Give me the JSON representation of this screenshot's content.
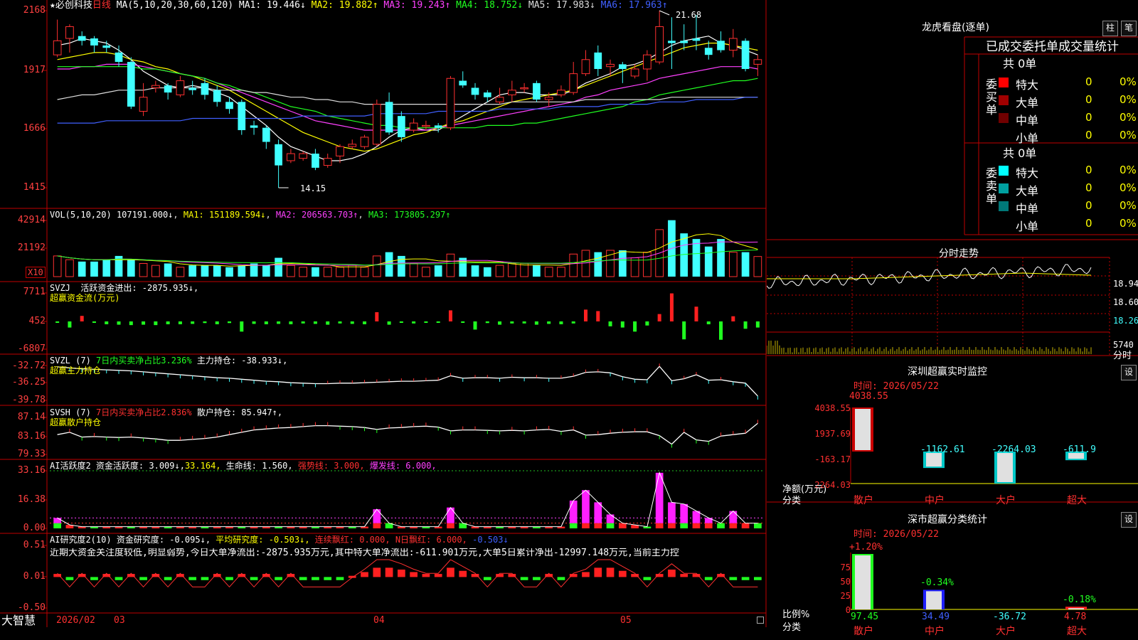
{
  "header": {
    "star": "★",
    "stock_name": "必创科技",
    "period": "日线",
    "ma_title": "MA(5,10,20,30,60,120)",
    "ma": [
      {
        "label": "MA1: 19.446↓",
        "color": "#ffffff"
      },
      {
        "label": "MA2: 19.882↑",
        "color": "#ffff00"
      },
      {
        "label": "MA3: 19.243↑",
        "color": "#ff40ff"
      },
      {
        "label": "MA4: 18.752↓",
        "color": "#20ff20"
      },
      {
        "label": "MA5: 17.983↓",
        "color": "#dddddd"
      },
      {
        "label": "MA6: 17.963↑",
        "color": "#4060ff"
      }
    ],
    "max_price": "21.68",
    "min_price": "14.15"
  },
  "price_axis": [
    "2168",
    "1917",
    "1666",
    "1415"
  ],
  "vol": {
    "title": "VOL(5,10,20)",
    "value": "107191.000↓",
    "ma1": "MA1: 151189.594↓",
    "ma2": "MA2: 206563.703↑",
    "ma3": "MA3: 173805.297↑",
    "axis": [
      "42914",
      "21192"
    ],
    "unit": "X10"
  },
  "svzj": {
    "title": "SVZJ",
    "line1": "活跃资金进出: -2875.935↓,",
    "line2": "超赢资金流(万元)",
    "axis": [
      "7711",
      "452",
      "-6807"
    ]
  },
  "svzl": {
    "title": "SVZL (7)",
    "pct": "7日内买卖净占比3.236%",
    "hold": "主力持仓: -38.933↓,",
    "line2": "超赢主力持仓",
    "axis": [
      "-32.72",
      "-36.25",
      "-39.78"
    ]
  },
  "svsh": {
    "title": "SVSH (7)",
    "pct": "7日内买卖净占比2.836%",
    "hold": "散户持仓: 85.947↑,",
    "line2": "超赢散户持仓",
    "axis": [
      "87.14",
      "83.16",
      "79.33"
    ]
  },
  "ai1": {
    "title": "AI活跃度2",
    "v1": "资金活跃度: 3.009↓,",
    "v2": "33.164,",
    "v3": "生命线: 1.560,",
    "v4": "强势线: 3.000,",
    "v5": "爆发线: 6.000,",
    "axis": [
      "33.16",
      "16.38",
      "0.00"
    ]
  },
  "ai2": {
    "title": "AI研究度2(10)",
    "v1": "资金研究度: -0.095↓,",
    "v2": "平均研究度: -0.503↓,",
    "v3": "连续飘红: 0.000,",
    "v4": "N日飘红: 6.000,",
    "v5": "-0.503↓",
    "note": "近期大资金关注度较低,明显弱势,今日大单净流出:-2875.935万元,其中特大单净流出:-611.901万元,大单5日累计净出-12997.148万元,当前主力控",
    "axis": [
      "0.51",
      "0.01",
      "-0.50"
    ]
  },
  "dates": {
    "brand": "大智慧",
    "labels": [
      "2026/02",
      "03",
      "04",
      "05"
    ]
  },
  "right": {
    "lhb_title": "龙虎看盘(逐单)",
    "btn_zhu": "柱",
    "btn_bi": "笔",
    "tabs": "已成交委托单成交量统计",
    "buy_label": "委买单",
    "sell_label": "委卖单",
    "buy_total": "共 0单",
    "sell_total": "共 0单",
    "buy_rows": [
      {
        "name": "特大",
        "n": "0",
        "p": "0%",
        "color": "#ff0000"
      },
      {
        "name": "大单",
        "n": "0",
        "p": "0%",
        "color": "#a00000"
      },
      {
        "name": "中单",
        "n": "0",
        "p": "0%",
        "color": "#700000"
      },
      {
        "name": "小单",
        "n": "0",
        "p": "0%",
        "color": ""
      }
    ],
    "sell_rows": [
      {
        "name": "特大",
        "n": "0",
        "p": "0%",
        "color": "#00ffff"
      },
      {
        "name": "大单",
        "n": "0",
        "p": "0%",
        "color": "#00a0a0"
      },
      {
        "name": "中单",
        "n": "0",
        "p": "0%",
        "color": "#007878"
      },
      {
        "name": "小单",
        "n": "0",
        "p": "0%",
        "color": ""
      }
    ],
    "fs_title": "分时走势",
    "fs_axis": [
      "18.94",
      "18.60",
      "18.26",
      "5740",
      "分时"
    ],
    "sz_title": "深圳超赢实时监控",
    "sz_btn": "设",
    "sz_time": "时间: 2026/05/22",
    "sz_axis": [
      "4038.55",
      "1937.69",
      "-163.17",
      "-2264.03"
    ],
    "sz_unit": "净额(万元)",
    "sz_cat": "分类",
    "sz_bars": [
      {
        "name": "散户",
        "value": 4038.55,
        "label": "4038.55"
      },
      {
        "name": "中户",
        "value": -1162.61,
        "label": "-1162.61"
      },
      {
        "name": "大户",
        "value": -2264.03,
        "label": "-2264.03"
      },
      {
        "name": "超大",
        "value": -611.9,
        "label": "-611.9"
      }
    ],
    "fl_title": "深市超赢分类统计",
    "fl_btn": "设",
    "fl_time": "时间: 2026/05/22",
    "fl_axis": [
      "75",
      "50",
      "25",
      "0"
    ],
    "fl_unit": "比例%",
    "fl_cat": "分类",
    "fl_bars": [
      {
        "name": "散户",
        "pct": "+1.20%",
        "ratio": 97.45,
        "val": "97.45"
      },
      {
        "name": "中户",
        "pct": "-0.34%",
        "ratio": 34.49,
        "val": "34.49"
      },
      {
        "name": "大户",
        "pct": "",
        "ratio": 0,
        "val": "-36.72"
      },
      {
        "name": "超大",
        "pct": "-0.18%",
        "ratio": 4.78,
        "val": "4.78"
      }
    ]
  },
  "chart_data": {
    "type": "candlestick",
    "y_range": [
      14.15,
      21.68
    ],
    "candles": [
      [
        19.8,
        20.4,
        21.3,
        19.7
      ],
      [
        20.5,
        21.0,
        21.1,
        19.9
      ],
      [
        20.6,
        20.4,
        20.8,
        20.2
      ],
      [
        20.5,
        20.2,
        20.6,
        19.9
      ],
      [
        20.2,
        20.1,
        20.4,
        19.9
      ],
      [
        19.9,
        19.5,
        20.2,
        19.3
      ],
      [
        19.5,
        17.6,
        19.7,
        17.5
      ],
      [
        17.4,
        18.0,
        18.6,
        17.2
      ],
      [
        18.4,
        18.5,
        18.7,
        18.2
      ],
      [
        18.5,
        18.2,
        18.6,
        17.9
      ],
      [
        18.1,
        18.7,
        18.9,
        18.0
      ],
      [
        18.4,
        18.3,
        18.7,
        18.1
      ],
      [
        18.6,
        18.1,
        18.8,
        17.9
      ],
      [
        18.3,
        17.8,
        18.5,
        17.6
      ],
      [
        17.8,
        17.5,
        18.0,
        17.3
      ],
      [
        17.8,
        16.6,
        17.9,
        16.4
      ],
      [
        16.8,
        16.7,
        17.0,
        16.4
      ],
      [
        16.7,
        16.1,
        16.8,
        15.8
      ],
      [
        16.0,
        15.1,
        16.2,
        14.15
      ],
      [
        15.3,
        15.6,
        15.8,
        15.2
      ],
      [
        15.4,
        15.6,
        15.7,
        15.3
      ],
      [
        15.6,
        15.0,
        15.8,
        14.9
      ],
      [
        15.1,
        15.4,
        15.6,
        15.0
      ],
      [
        15.5,
        15.9,
        16.0,
        15.2
      ],
      [
        15.9,
        16.0,
        16.2,
        15.8
      ],
      [
        15.9,
        16.3,
        16.4,
        15.8
      ],
      [
        16.0,
        17.7,
        17.9,
        15.9
      ],
      [
        17.8,
        16.5,
        18.2,
        16.4
      ],
      [
        17.2,
        16.3,
        17.4,
        16.1
      ],
      [
        16.6,
        16.9,
        17.1,
        16.5
      ],
      [
        16.8,
        16.8,
        17.0,
        16.6
      ],
      [
        16.8,
        16.7,
        16.9,
        16.5
      ],
      [
        16.7,
        18.8,
        18.9,
        16.6
      ],
      [
        18.7,
        18.5,
        19.1,
        18.4
      ],
      [
        18.4,
        18.1,
        18.6,
        17.9
      ],
      [
        18.2,
        18.0,
        18.3,
        17.8
      ],
      [
        17.8,
        18.0,
        18.4,
        17.7
      ],
      [
        18.1,
        18.3,
        18.7,
        17.8
      ],
      [
        18.4,
        18.4,
        18.6,
        18.2
      ],
      [
        18.6,
        17.9,
        18.7,
        17.8
      ],
      [
        17.9,
        18.0,
        18.2,
        17.6
      ],
      [
        18.1,
        18.3,
        18.5,
        18.0
      ],
      [
        18.2,
        19.0,
        19.5,
        18.1
      ],
      [
        19.0,
        19.6,
        20.0,
        18.9
      ],
      [
        19.9,
        19.2,
        20.2,
        18.9
      ],
      [
        19.3,
        19.4,
        19.6,
        18.9
      ],
      [
        19.4,
        19.2,
        19.5,
        18.6
      ],
      [
        18.9,
        19.2,
        19.4,
        18.8
      ],
      [
        19.2,
        19.8,
        20.0,
        18.7
      ],
      [
        19.5,
        21.0,
        21.68,
        19.4
      ],
      [
        20.4,
        20.3,
        21.4,
        19.2
      ],
      [
        20.4,
        20.3,
        21.1,
        20.0
      ],
      [
        20.5,
        20.4,
        21.5,
        20.0
      ],
      [
        20.1,
        19.8,
        20.4,
        19.6
      ],
      [
        20.4,
        20.0,
        20.8,
        19.9
      ],
      [
        20.0,
        20.5,
        20.9,
        19.7
      ],
      [
        20.4,
        19.2,
        20.5,
        19.1
      ],
      [
        19.4,
        19.6,
        19.8,
        18.9
      ]
    ],
    "ma_lines": [
      {
        "name": "MA1",
        "color": "#ffffff",
        "values": [
          20.2,
          20.3,
          20.5,
          20.4,
          20.3,
          20.0,
          19.6,
          19.1,
          18.8,
          18.5,
          18.4,
          18.5,
          18.4,
          18.2,
          18.0,
          17.6,
          17.2,
          16.8,
          16.3,
          15.9,
          15.7,
          15.5,
          15.3,
          15.3,
          15.4,
          15.6,
          15.9,
          16.3,
          16.6,
          16.7,
          16.6,
          16.6,
          16.9,
          17.2,
          17.5,
          17.8,
          18.1,
          18.2,
          18.2,
          18.1,
          18.1,
          18.1,
          18.3,
          18.6,
          18.8,
          19.0,
          19.3,
          19.4,
          19.6,
          19.9,
          20.2,
          20.4,
          20.5,
          20.6,
          20.3,
          20.2,
          20.0,
          19.8
        ]
      },
      {
        "name": "MA2",
        "color": "#ffff00",
        "values": [
          19.6,
          19.7,
          19.8,
          19.9,
          19.9,
          19.8,
          19.6,
          19.5,
          19.3,
          19.2,
          19.0,
          18.9,
          18.7,
          18.5,
          18.3,
          18.0,
          17.7,
          17.4,
          17.1,
          16.8,
          16.5,
          16.3,
          16.1,
          15.9,
          15.8,
          15.7,
          15.8,
          16.0,
          16.2,
          16.4,
          16.5,
          16.7,
          16.9,
          17.0,
          17.2,
          17.4,
          17.6,
          17.8,
          17.9,
          18.0,
          18.1,
          18.2,
          18.3,
          18.5,
          18.7,
          18.9,
          19.1,
          19.3,
          19.5,
          19.7,
          19.9,
          20.1,
          20.2,
          20.3,
          20.3,
          20.2,
          20.1,
          20.0
        ]
      },
      {
        "name": "MA3",
        "color": "#ff40ff",
        "values": [
          19.2,
          19.2,
          19.3,
          19.3,
          19.4,
          19.4,
          19.4,
          19.3,
          19.2,
          19.1,
          19.0,
          18.9,
          18.8,
          18.6,
          18.4,
          18.2,
          18.0,
          17.8,
          17.6,
          17.4,
          17.2,
          17.0,
          16.9,
          16.8,
          16.7,
          16.6,
          16.6,
          16.6,
          16.6,
          16.6,
          16.6,
          16.7,
          16.8,
          16.9,
          17.0,
          17.1,
          17.2,
          17.3,
          17.4,
          17.5,
          17.6,
          17.7,
          17.8,
          18.0,
          18.1,
          18.3,
          18.4,
          18.5,
          18.6,
          18.8,
          18.9,
          19.0,
          19.1,
          19.2,
          19.3,
          19.3,
          19.3,
          19.2
        ]
      },
      {
        "name": "MA4",
        "color": "#20ff20",
        "values": [
          19.3,
          19.3,
          19.3,
          19.3,
          19.3,
          19.3,
          19.3,
          19.2,
          19.2,
          19.1,
          19.0,
          18.9,
          18.8,
          18.6,
          18.5,
          18.3,
          18.2,
          18.0,
          17.8,
          17.6,
          17.5,
          17.4,
          17.2,
          17.1,
          17.0,
          16.9,
          16.8,
          16.8,
          16.7,
          16.7,
          16.7,
          16.7,
          16.7,
          16.7,
          16.7,
          16.8,
          16.8,
          16.8,
          16.9,
          16.9,
          17.0,
          17.1,
          17.2,
          17.3,
          17.4,
          17.5,
          17.6,
          17.8,
          17.9,
          18.1,
          18.2,
          18.3,
          18.4,
          18.5,
          18.6,
          18.7,
          18.7,
          18.8
        ]
      },
      {
        "name": "MA5",
        "color": "#dddddd",
        "values": [
          17.9,
          18.0,
          18.1,
          18.1,
          18.2,
          18.3,
          18.3,
          18.3,
          18.4,
          18.4,
          18.4,
          18.4,
          18.4,
          18.3,
          18.3,
          18.3,
          18.2,
          18.2,
          18.1,
          18.0,
          18.0,
          17.9,
          17.9,
          17.8,
          17.8,
          17.7,
          17.7,
          17.7,
          17.7,
          17.7,
          17.7,
          17.7,
          17.7,
          17.7,
          17.7,
          17.7,
          17.7,
          17.8,
          17.8,
          17.8,
          17.8,
          17.8,
          17.8,
          17.9,
          17.9,
          17.9,
          17.9,
          17.9,
          17.9,
          17.9,
          18.0,
          18.0,
          18.0,
          18.0,
          18.0,
          18.0,
          18.0,
          18.0
        ]
      },
      {
        "name": "MA6",
        "color": "#4060ff",
        "values": [
          16.9,
          16.9,
          16.9,
          16.9,
          17.0,
          17.0,
          17.0,
          17.0,
          17.0,
          17.0,
          17.0,
          17.1,
          17.1,
          17.1,
          17.1,
          17.1,
          17.1,
          17.1,
          17.1,
          17.1,
          17.2,
          17.2,
          17.2,
          17.2,
          17.2,
          17.2,
          17.3,
          17.3,
          17.3,
          17.3,
          17.3,
          17.4,
          17.4,
          17.4,
          17.4,
          17.4,
          17.5,
          17.5,
          17.5,
          17.5,
          17.5,
          17.6,
          17.6,
          17.6,
          17.6,
          17.7,
          17.7,
          17.7,
          17.7,
          17.8,
          17.8,
          17.8,
          17.9,
          17.9,
          17.9,
          17.9,
          18.0,
          18.0
        ]
      }
    ],
    "volume": [
      110,
      90,
      80,
      80,
      90,
      110,
      90,
      70,
      60,
      70,
      50,
      60,
      60,
      60,
      50,
      60,
      70,
      60,
      100,
      60,
      50,
      50,
      50,
      50,
      60,
      50,
      110,
      130,
      110,
      70,
      50,
      60,
      120,
      100,
      60,
      50,
      60,
      70,
      70,
      60,
      50,
      50,
      120,
      140,
      130,
      140,
      140,
      100,
      130,
      250,
      300,
      230,
      200,
      160,
      200,
      130,
      130,
      107
    ],
    "zj_flow": [
      -300,
      -1500,
      1500,
      -200,
      -700,
      -800,
      -900,
      -800,
      -900,
      -700,
      -700,
      -600,
      -400,
      -700,
      -400,
      -2500,
      -600,
      -700,
      -600,
      -700,
      -500,
      -600,
      -800,
      -500,
      -600,
      -700,
      2500,
      -800,
      -300,
      -500,
      -200,
      -100,
      3000,
      -200,
      -2000,
      -400,
      -800,
      -500,
      -500,
      -800,
      -600,
      -700,
      -500,
      3200,
      2800,
      -1200,
      -1500,
      -2500,
      -1000,
      2000,
      7600,
      -4400,
      4000,
      -700,
      -4500,
      1400,
      -1800,
      -1500
    ],
    "zl_line": [
      -33.0,
      -33.2,
      -33.4,
      -33.5,
      -33.6,
      -33.7,
      -33.8,
      -34.0,
      -34.2,
      -34.4,
      -34.6,
      -34.8,
      -35.0,
      -35.2,
      -35.3,
      -35.5,
      -35.7,
      -35.9,
      -36.0,
      -36.2,
      -36.3,
      -36.4,
      -36.4,
      -36.3,
      -36.3,
      -36.2,
      -36.1,
      -36.0,
      -35.9,
      -35.9,
      -35.8,
      -35.7,
      -34.8,
      -35.3,
      -35.2,
      -35.2,
      -35.3,
      -35.1,
      -35.2,
      -35.2,
      -35.3,
      -35.3,
      -34.9,
      -34.1,
      -34.0,
      -34.2,
      -35.0,
      -35.5,
      -35.6,
      -32.9,
      -35.8,
      -35.4,
      -34.6,
      -35.7,
      -35.6,
      -36.0,
      -36.3,
      -38.9
    ],
    "sh_line": [
      83.5,
      84.0,
      83.0,
      83.1,
      83.0,
      82.9,
      83.0,
      82.8,
      82.6,
      82.3,
      82.3,
      82.5,
      82.7,
      83.0,
      83.5,
      84.0,
      84.5,
      84.7,
      84.9,
      85.0,
      85.2,
      85.4,
      85.4,
      85.3,
      85.2,
      85.0,
      84.6,
      84.9,
      85.0,
      85.2,
      85.3,
      85.1,
      84.3,
      84.5,
      84.5,
      84.4,
      84.3,
      84.4,
      84.3,
      84.5,
      84.6,
      84.2,
      84.5,
      83.4,
      83.5,
      83.8,
      84.0,
      84.1,
      84.1,
      83.3,
      81.5,
      84.0,
      82.4,
      82.1,
      83.2,
      83.5,
      83.8,
      85.9
    ],
    "ai_active": [
      6,
      2,
      1,
      1,
      1,
      1,
      1,
      1,
      1,
      1,
      1,
      1,
      1,
      1,
      1,
      1,
      1,
      1,
      1,
      1,
      1,
      1,
      1,
      1,
      1,
      1,
      11,
      3,
      1,
      1,
      1,
      1,
      12,
      3,
      1,
      1,
      1,
      1,
      1,
      1,
      1,
      1,
      16,
      22,
      15,
      8,
      3,
      2,
      1,
      32,
      15,
      14,
      10,
      6,
      3,
      10,
      3,
      3
    ],
    "ai_study": [
      0.05,
      -0.05,
      0.05,
      -0.05,
      0.05,
      -0.05,
      0.05,
      -0.05,
      0.05,
      -0.05,
      0.05,
      -0.05,
      -0.05,
      0.05,
      -0.05,
      0.05,
      -0.05,
      0.05,
      -0.05,
      0.05,
      -0.05,
      -0.05,
      -0.05,
      -0.05,
      0.02,
      0.08,
      0.15,
      0.15,
      0.12,
      0.08,
      0.05,
      0.05,
      0.15,
      0.1,
      0.05,
      -0.05,
      0.05,
      0.05,
      -0.05,
      -0.05,
      0.05,
      -0.05,
      0.05,
      0.08,
      0.15,
      0.15,
      0.1,
      0.05,
      -0.05,
      0.05,
      0.12,
      0.05,
      0.05,
      -0.05,
      0.05,
      -0.05,
      -0.05,
      -0.05
    ]
  }
}
